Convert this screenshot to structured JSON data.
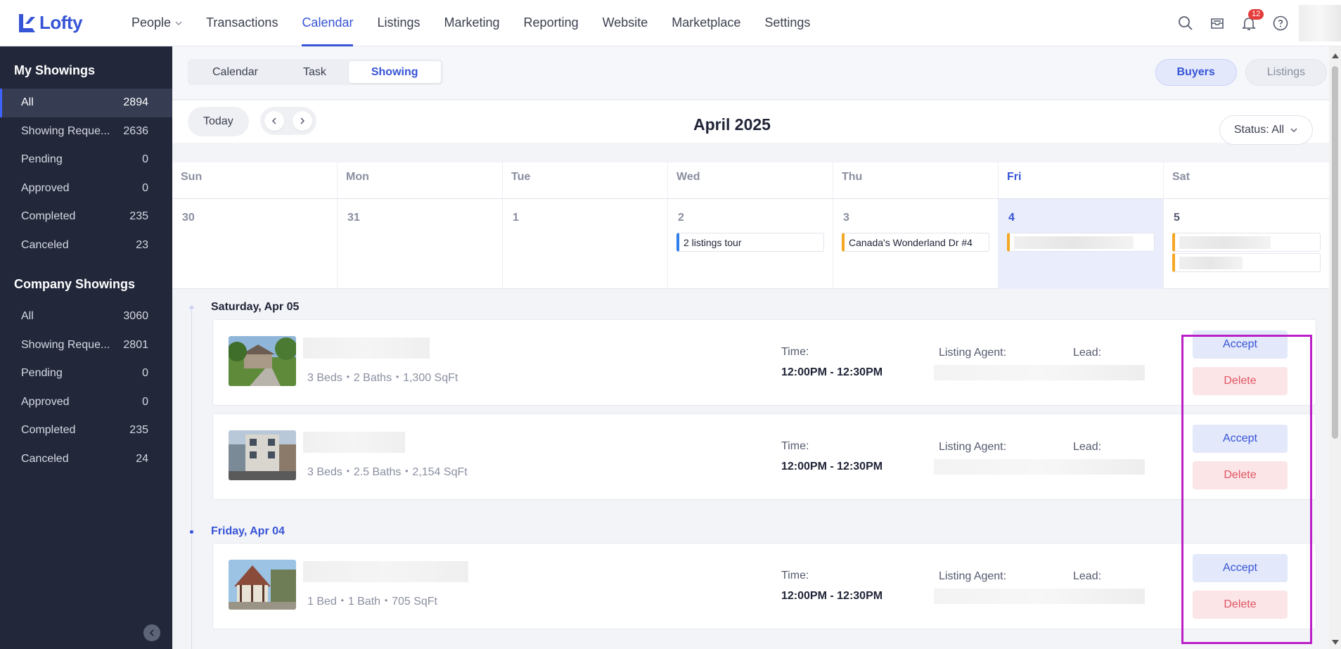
{
  "app": {
    "logo_text": "Lofty"
  },
  "nav": {
    "items": [
      {
        "label": "People",
        "dropdown": true
      },
      {
        "label": "Transactions"
      },
      {
        "label": "Calendar",
        "active": true
      },
      {
        "label": "Listings"
      },
      {
        "label": "Marketing"
      },
      {
        "label": "Reporting"
      },
      {
        "label": "Website"
      },
      {
        "label": "Marketplace"
      },
      {
        "label": "Settings"
      }
    ],
    "notification_count": "12",
    "icons": [
      "search-icon",
      "inbox-icon",
      "bell-icon",
      "help-icon"
    ]
  },
  "sidebar": {
    "my_title": "My Showings",
    "my_items": [
      {
        "label": "All",
        "count": "2894"
      },
      {
        "label": "Showing Reque...",
        "count": "2636"
      },
      {
        "label": "Pending",
        "count": "0"
      },
      {
        "label": "Approved",
        "count": "0"
      },
      {
        "label": "Completed",
        "count": "235"
      },
      {
        "label": "Canceled",
        "count": "23"
      }
    ],
    "company_title": "Company Showings",
    "company_items": [
      {
        "label": "All",
        "count": "3060"
      },
      {
        "label": "Showing Reque...",
        "count": "2801"
      },
      {
        "label": "Pending",
        "count": "0"
      },
      {
        "label": "Approved",
        "count": "0"
      },
      {
        "label": "Completed",
        "count": "235"
      },
      {
        "label": "Canceled",
        "count": "24"
      }
    ]
  },
  "toolbar": {
    "tabs": [
      "Calendar",
      "Task",
      "Showing"
    ],
    "active_tab": "Showing",
    "toggle": [
      "Buyers",
      "Listings"
    ],
    "active_toggle": "Buyers"
  },
  "calendar": {
    "today_label": "Today",
    "month_title": "April 2025",
    "status_filter": "Status: All",
    "days": [
      "Sun",
      "Mon",
      "Tue",
      "Wed",
      "Thu",
      "Fri",
      "Sat"
    ],
    "dates": [
      "30",
      "31",
      "1",
      "2",
      "3",
      "4",
      "5"
    ],
    "events": {
      "wed": "2 listings tour",
      "thu": "Canada's Wonderland Dr #4"
    }
  },
  "list": {
    "groups": [
      {
        "date": "Saturday, Apr 05"
      },
      {
        "date": "Friday, Apr 04"
      }
    ],
    "labels": {
      "time": "Time:",
      "agent": "Listing Agent:",
      "lead": "Lead:",
      "accept": "Accept",
      "delete": "Delete"
    },
    "cards": [
      {
        "specs": "3 Beds・2 Baths・1,300 SqFt",
        "time": "12:00PM - 12:30PM"
      },
      {
        "specs": "3 Beds・2.5 Baths・2,154 SqFt",
        "time": "12:00PM - 12:30PM"
      },
      {
        "specs": "1 Bed・1 Bath・705 SqFt",
        "time": "12:00PM - 12:30PM"
      }
    ]
  },
  "colors": {
    "accent": "#3654d6",
    "sidebar_bg": "#22273a",
    "highlight": "#bb1fc7"
  }
}
